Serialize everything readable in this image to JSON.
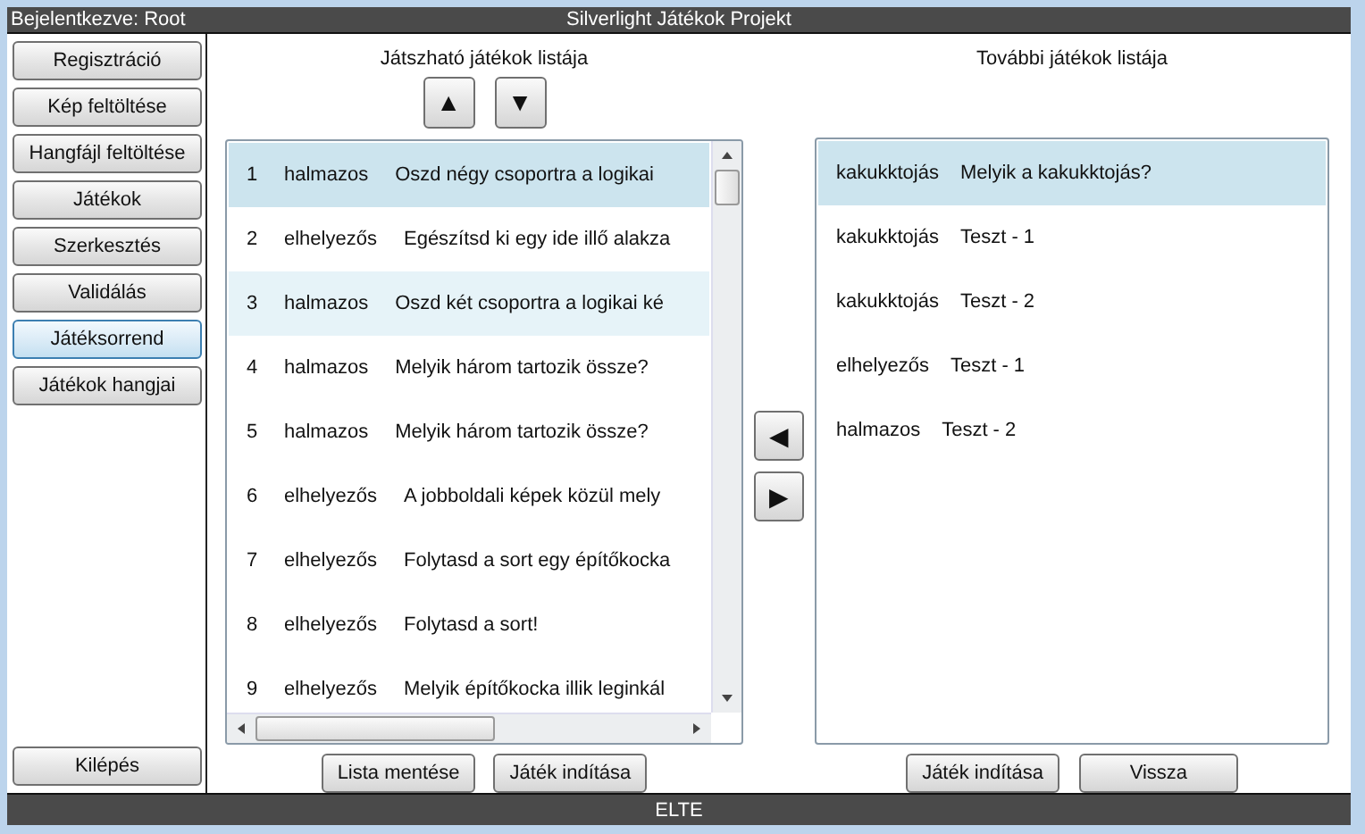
{
  "window": {
    "user_label": "Bejelentkezve: Root",
    "title": "Silverlight Játékok Projekt",
    "footer": "ELTE"
  },
  "sidebar": {
    "items": [
      {
        "label": "Regisztráció",
        "selected": false
      },
      {
        "label": "Kép feltöltése",
        "selected": false
      },
      {
        "label": "Hangfájl feltöltése",
        "selected": false
      },
      {
        "label": "Játékok",
        "selected": false
      },
      {
        "label": "Szerkesztés",
        "selected": false
      },
      {
        "label": "Validálás",
        "selected": false
      },
      {
        "label": "Játéksorrend",
        "selected": true
      },
      {
        "label": "Játékok hangjai",
        "selected": false
      }
    ],
    "exit_button": "Kilépés"
  },
  "playable_list": {
    "heading": "Játszható játékok listája",
    "up_button": "▲",
    "down_button": "▼",
    "rows": [
      {
        "index": "1",
        "type": "halmazos",
        "title": "Oszd négy csoportra a logikai",
        "selected": true,
        "hovered": false
      },
      {
        "index": "2",
        "type": "elhelyezős",
        "title": "Egészítsd ki egy ide illő alakza",
        "selected": false,
        "hovered": false
      },
      {
        "index": "3",
        "type": "halmazos",
        "title": "Oszd két csoportra a logikai ké",
        "selected": false,
        "hovered": true
      },
      {
        "index": "4",
        "type": "halmazos",
        "title": "Melyik három tartozik össze?",
        "selected": false,
        "hovered": false
      },
      {
        "index": "5",
        "type": "halmazos",
        "title": "Melyik három tartozik össze?",
        "selected": false,
        "hovered": false
      },
      {
        "index": "6",
        "type": "elhelyezős",
        "title": "A jobboldali képek közül mely",
        "selected": false,
        "hovered": false
      },
      {
        "index": "7",
        "type": "elhelyezős",
        "title": "Folytasd a sort egy építőkocka",
        "selected": false,
        "hovered": false
      },
      {
        "index": "8",
        "type": "elhelyezős",
        "title": "Folytasd a sort!",
        "selected": false,
        "hovered": false
      },
      {
        "index": "9",
        "type": "elhelyezős",
        "title": "Melyik építőkocka illik leginkál",
        "selected": false,
        "hovered": false
      }
    ],
    "buttons": [
      "Lista mentése",
      "Játék indítása"
    ]
  },
  "move_buttons": [
    "◀",
    "▶"
  ],
  "other_list": {
    "heading": "További játékok listája",
    "rows": [
      {
        "type": "kakukktojás",
        "title": "Melyik a kakukktojás?",
        "selected": true
      },
      {
        "type": "kakukktojás",
        "title": "Teszt - 1",
        "selected": false
      },
      {
        "type": "kakukktojás",
        "title": "Teszt - 2",
        "selected": false
      },
      {
        "type": "elhelyezős",
        "title": "Teszt - 1",
        "selected": false
      },
      {
        "type": "halmazos",
        "title": "Teszt - 2",
        "selected": false
      }
    ],
    "buttons": [
      "Játék indítása",
      "Vissza"
    ]
  }
}
